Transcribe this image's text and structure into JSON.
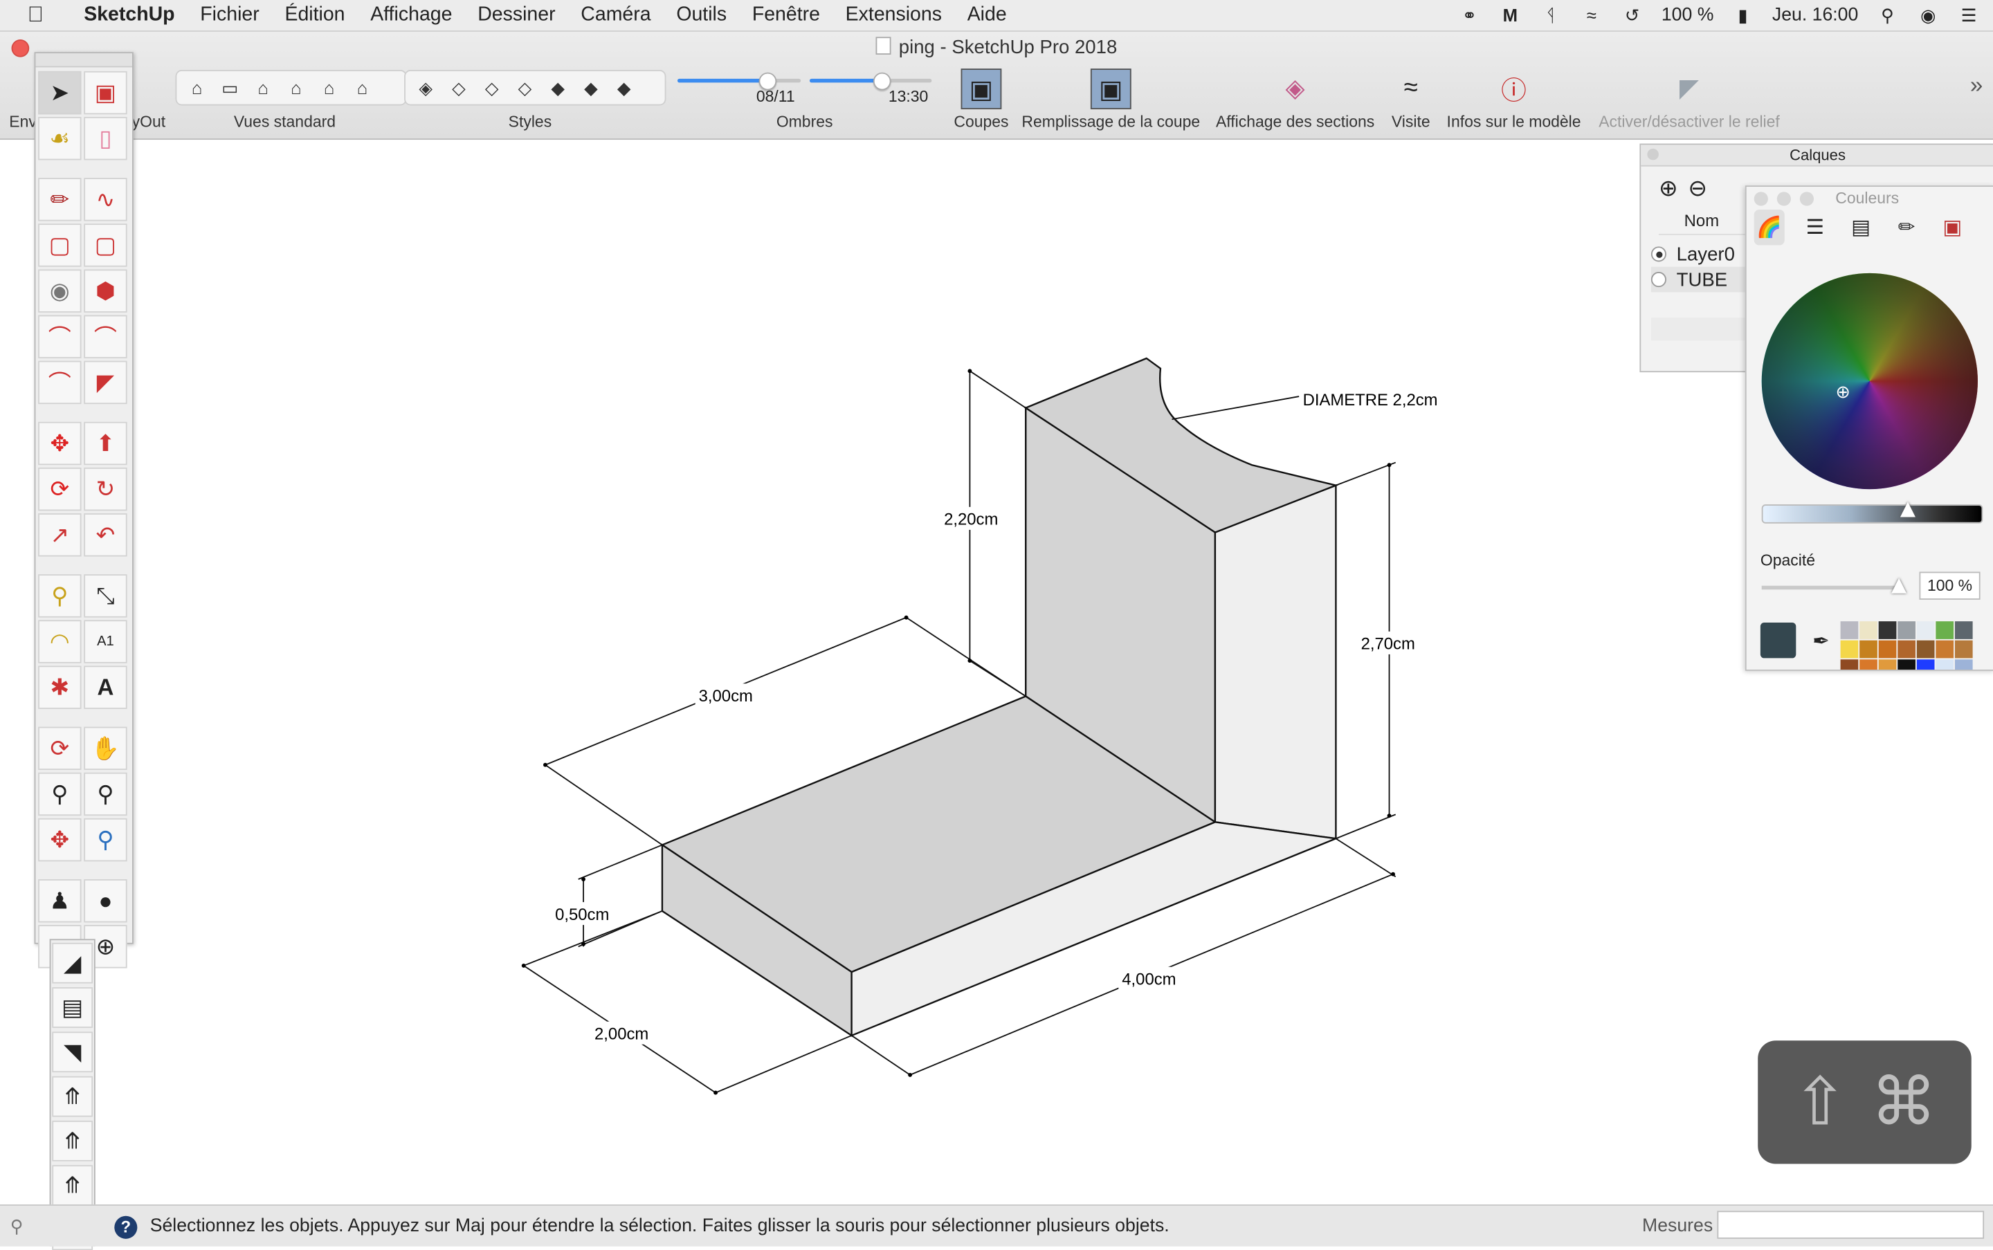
{
  "menubar": {
    "app": "SketchUp",
    "items": [
      "Fichier",
      "Édition",
      "Affichage",
      "Dessiner",
      "Caméra",
      "Outils",
      "Fenêtre",
      "Extensions",
      "Aide"
    ],
    "battery": "100 %",
    "clock": "Jeu. 16:00"
  },
  "window": {
    "title": "ping - SketchUp Pro 2018"
  },
  "toolbar": {
    "left_partial_label": "Env",
    "layout_partial_label": "yOut",
    "standard_views_label": "Vues standard",
    "styles_label": "Styles",
    "shadows_label": "Ombres",
    "shadow_date": "08/11",
    "shadow_time": "13:30",
    "shadow_date_level": 0.72,
    "shadow_time_level": 0.58,
    "sections_label": "Coupes",
    "section_fill_label": "Remplissage de la coupe",
    "section_display_label": "Affichage des sections",
    "walk_label": "Visite",
    "model_info_label": "Infos sur le modèle",
    "terrain_toggle_label": "Activer/désactiver le relief"
  },
  "drawing": {
    "dim_height_top": "2,20cm",
    "dim_depth_top": "3,00cm",
    "dim_height_right": "2,70cm",
    "dim_thickness": "0,50cm",
    "dim_width_front": "2,00cm",
    "dim_length": "4,00cm",
    "diameter_note": "DIAMETRE 2,2cm"
  },
  "layers_panel": {
    "title": "Calques",
    "column_name": "Nom",
    "layers": [
      {
        "name": "Layer0",
        "active": true
      },
      {
        "name": "TUBE",
        "active": false
      }
    ]
  },
  "colors_panel": {
    "title": "Couleurs",
    "opacity_label": "Opacité",
    "opacity_value": "100 %",
    "current_color": "#34474f"
  },
  "statusbar": {
    "help_glyph": "?",
    "hint": "Sélectionnez les objets. Appuyez sur Maj pour étendre la sélection. Faites glisser la souris pour sélectionner plusieurs objets.",
    "measurements_label": "Mesures",
    "measurements_value": ""
  }
}
